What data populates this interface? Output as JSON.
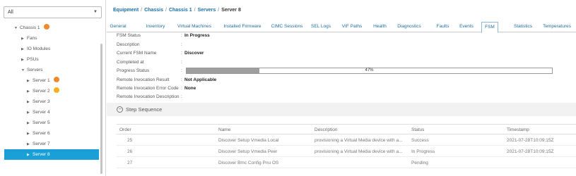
{
  "sidebar": {
    "filter_value": "All",
    "tree": [
      {
        "label": "Chassis 1",
        "arrow": "▼",
        "badge": "orange"
      },
      {
        "label": "Fans",
        "arrow": "▶",
        "badge": ""
      },
      {
        "label": "IO Modules",
        "arrow": "▶",
        "badge": ""
      },
      {
        "label": "PSUs",
        "arrow": "▶",
        "badge": ""
      },
      {
        "label": "Servers",
        "arrow": "▼",
        "badge": ""
      },
      {
        "label": "Server 1",
        "arrow": "▶",
        "badge": "orange"
      },
      {
        "label": "Server 2",
        "arrow": "▶",
        "badge": "yellow"
      },
      {
        "label": "Server 3",
        "arrow": "▶",
        "badge": ""
      },
      {
        "label": "Server 4",
        "arrow": "▶",
        "badge": ""
      },
      {
        "label": "Server 5",
        "arrow": "▶",
        "badge": ""
      },
      {
        "label": "Server 6",
        "arrow": "▶",
        "badge": ""
      },
      {
        "label": "Server 7",
        "arrow": "▶",
        "badge": ""
      },
      {
        "label": "Server 8",
        "arrow": "▶",
        "badge": "",
        "selected": true
      }
    ]
  },
  "breadcrumb": {
    "items": [
      "Equipment",
      "Chassis",
      "Chassis 1",
      "Servers"
    ],
    "current": "Server 8"
  },
  "tabs": [
    {
      "label": "General"
    },
    {
      "label": "Inventory"
    },
    {
      "label": "Virtual Machines"
    },
    {
      "label": "Installed Firmware"
    },
    {
      "label": "CIMC Sessions"
    },
    {
      "label": "SEL Logs"
    },
    {
      "label": "VIF Paths"
    },
    {
      "label": "Health"
    },
    {
      "label": "Diagnostics"
    },
    {
      "label": "Faults"
    },
    {
      "label": "Events"
    },
    {
      "label": "FSM",
      "active": true
    },
    {
      "label": "Statistics"
    },
    {
      "label": "Temperatures"
    }
  ],
  "fsm": {
    "rows": [
      {
        "label": "FSM Status",
        "value": "In Progress"
      },
      {
        "label": "Description",
        "value": ""
      },
      {
        "label": "Current FSM Name",
        "value": "Discover"
      },
      {
        "label": "Completed at",
        "value": ""
      },
      {
        "label": "Progress Status",
        "value": ""
      },
      {
        "label": "Remote Invocation Result",
        "value": "Not Applicable"
      },
      {
        "label": "Remote Invocation Error Code",
        "value": "None"
      },
      {
        "label": "Remote Invocation Description",
        "value": ""
      }
    ],
    "progress_percent": 47,
    "progress_text": "47%"
  },
  "step_sequence": {
    "title": "Step Sequence",
    "columns": [
      "Order",
      "Name",
      "Description",
      "Status",
      "Timestamp"
    ],
    "rows": [
      [
        "25",
        "Discover Setup Vmedia Local",
        "provisioning a Virtual Media device with a...",
        "Success",
        "2021-07-28T10:09:15Z"
      ],
      [
        "26",
        "Discover Setup Vmedia Peer",
        "provisioning a Virtual Media device with a...",
        "In Progress",
        "2021-07-28T10:09:15Z"
      ],
      [
        "27",
        "Discover Bmc Config Pnu OS",
        "",
        "Pending",
        ""
      ]
    ]
  },
  "colors": {
    "accent": "#1aa0d6",
    "link": "#1b6fa8",
    "badge_orange": "#f0892c",
    "badge_yellow": "#f3b21b",
    "progress_fill": "#9e9e9e"
  }
}
